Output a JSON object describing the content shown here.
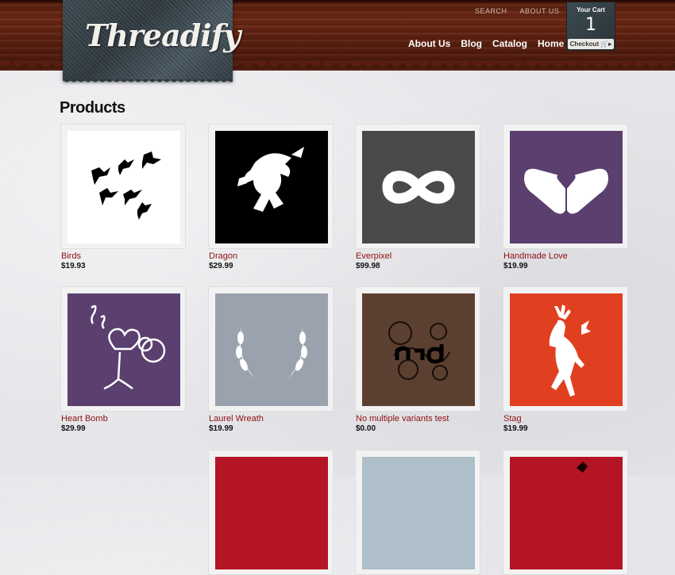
{
  "header": {
    "logo_text": "Threadify",
    "util_links": [
      "SEARCH",
      "ABOUT US"
    ],
    "nav": [
      "About Us",
      "Blog",
      "Catalog",
      "Home"
    ],
    "cart": {
      "title": "Your Cart",
      "count": "1",
      "checkout_label": "Checkout"
    }
  },
  "page_title": "Products",
  "products": [
    {
      "name": "Birds",
      "price": "$19.93",
      "bg": "#ffffff"
    },
    {
      "name": "Dragon",
      "price": "$29.99",
      "bg": "#000000"
    },
    {
      "name": "Everpixel",
      "price": "$99.98",
      "bg": "#4a4a4a"
    },
    {
      "name": "Handmade Love",
      "price": "$19.99",
      "bg": "#5a3f6f"
    },
    {
      "name": "Heart Bomb",
      "price": "$29.99",
      "bg": "#5a3f6f"
    },
    {
      "name": "Laurel Wreath",
      "price": "$19.99",
      "bg": "#9aa3ad"
    },
    {
      "name": "No multiple variants test",
      "price": "$0.00",
      "bg": "#5b3f30"
    },
    {
      "name": "Stag",
      "price": "$19.99",
      "bg": "#e04020"
    },
    {
      "name": "",
      "price": "",
      "bg": "#b41525"
    },
    {
      "name": "",
      "price": "",
      "bg": "#aebfc9"
    },
    {
      "name": "",
      "price": "",
      "bg": "#b41525"
    }
  ],
  "colors": {
    "wood": "#5a1f0f",
    "product_link": "#8c1010",
    "denim": "#3d4a52"
  }
}
